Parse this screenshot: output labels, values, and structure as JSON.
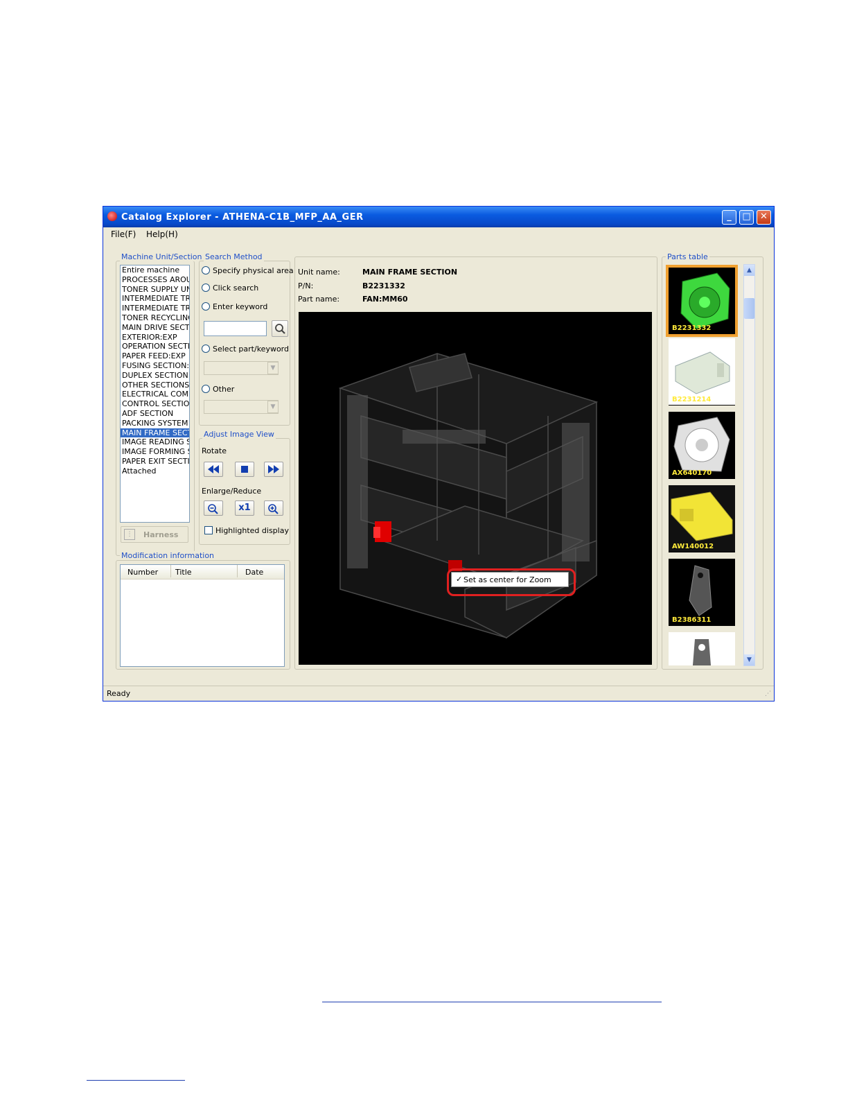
{
  "window": {
    "title": "Catalog Explorer - ATHENA-C1B_MFP_AA_GER"
  },
  "menu": [
    {
      "label": "File(F)"
    },
    {
      "label": "Help(H)"
    }
  ],
  "machine_unit": {
    "label": "Machine Unit/Section",
    "items": [
      "Entire machine",
      "PROCESSES AROU",
      "TONER SUPPLY UN",
      "INTERMEDIATE TR",
      "INTERMEDIATE TR",
      "TONER RECYCLINC",
      "MAIN DRIVE SECTI",
      "EXTERIOR:EXP",
      "OPERATION SECTI",
      "PAPER FEED:EXP",
      "FUSING SECTION:I",
      "DUPLEX SECTION:I",
      "OTHER SECTIONS:",
      "ELECTRICAL COMF",
      "CONTROL SECTIOI",
      "ADF SECTION",
      "PACKING SYSTEM",
      "MAIN FRAME SECT",
      "IMAGE READING S",
      "IMAGE FORMING S",
      "PAPER EXIT SECTI",
      "Attached"
    ],
    "selected_index": 17,
    "harness_label": "Harness"
  },
  "search_method": {
    "label": "Search Method",
    "options": [
      "Specify physical area",
      "Click search",
      "Enter keyword",
      "Select part/keyword",
      "Other"
    ]
  },
  "adjust_view": {
    "label": "Adjust Image View",
    "rotate_label": "Rotate",
    "enlarge_label": "Enlarge/Reduce",
    "x1_label": "x1",
    "highlighted_label": "Highlighted display"
  },
  "modification": {
    "label": "Modification information",
    "columns": [
      "Number",
      "Title",
      "Date"
    ]
  },
  "unit_info": {
    "unit_label": "Unit name:",
    "unit_value": "MAIN FRAME SECTION",
    "pn_label": "P/N:",
    "pn_value": "B2231332",
    "part_label": "Part name:",
    "part_value": "FAN:MM60"
  },
  "viewer": {
    "context_menu_item": "Set as center for Zoom"
  },
  "parts_table": {
    "label": "Parts table",
    "items": [
      {
        "pn": "B2231332",
        "selected": true
      },
      {
        "pn": "B2231214"
      },
      {
        "pn": "AX640170"
      },
      {
        "pn": "AW140012"
      },
      {
        "pn": "B2386311"
      },
      {
        "pn": ""
      }
    ]
  },
  "status": {
    "text": "Ready"
  },
  "colors": {
    "title_bar": "#0A5BE0",
    "selection": "#316AC5",
    "group_label": "#1F4FC8",
    "highlight_part": "#E00000",
    "thumb_label": "#FFEA3A"
  }
}
